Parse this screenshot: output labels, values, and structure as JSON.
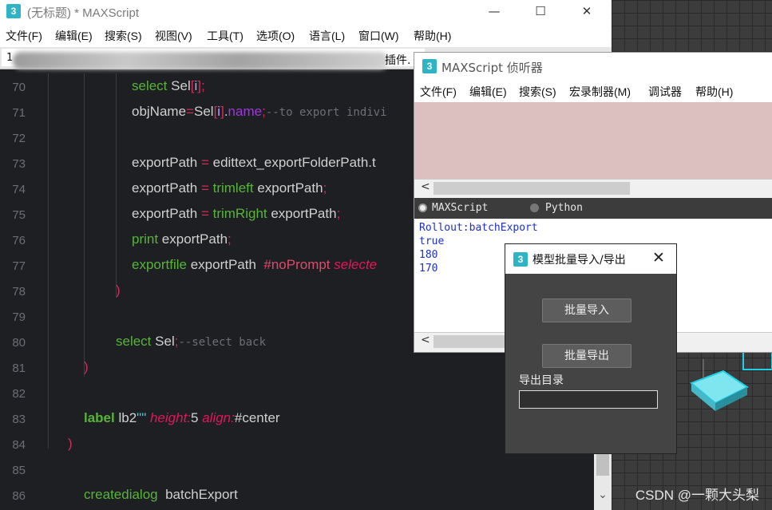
{
  "editor": {
    "title": "(无标题) * MAXScript",
    "logo_char": "3",
    "window_controls": {
      "minimize": "—",
      "maximize": "☐",
      "close": "✕"
    },
    "menu": [
      "文件(F)",
      "编辑(E)",
      "搜索(S)",
      "视图(V)",
      "工具(T)",
      "选项(O)",
      "语言(L)",
      "窗口(W)",
      "帮助(H)"
    ],
    "tab": {
      "index": "1",
      "suffix": "插件."
    },
    "line_numbers": [
      "70",
      "71",
      "72",
      "73",
      "74",
      "75",
      "76",
      "77",
      "78",
      "79",
      "80",
      "81",
      "82",
      "83",
      "84",
      "85",
      "86"
    ]
  },
  "code": {
    "l70": {
      "kw": "select",
      "rest": " Sel",
      "b1": "[",
      "idx": "i",
      "b2": "];"
    },
    "l71": {
      "a": "objName",
      "eq": "=",
      "b": "Sel",
      "b1": "[",
      "idx": "i",
      "b2": "]",
      "dot": ".",
      "prop": "name",
      "semi": ";",
      "cm": "--to export indivi"
    },
    "l73": {
      "a": "exportPath",
      "eq": " = ",
      "b": "edittext_exportFolderPath.t"
    },
    "l74": {
      "a": "exportPath",
      "eq": " = ",
      "fn": "trimleft",
      "b": " exportPath",
      "semi": ";"
    },
    "l75": {
      "a": "exportPath",
      "eq": " = ",
      "fn": "trimRight",
      "b": " exportPath",
      "semi": ";"
    },
    "l76": {
      "fn": "print",
      "b": " exportPath",
      "semi": ";"
    },
    "l77": {
      "fn": "exportfile",
      "b": " exportPath  ",
      "flag": "#noPrompt",
      "it": " selecte"
    },
    "l78": {
      "p": ")"
    },
    "l80": {
      "kw": "select",
      "b": " Sel",
      "semi": ";",
      "cm": "--select back"
    },
    "l81": {
      "p": ")"
    },
    "l83": {
      "kw": "label",
      "b": " lb2",
      "str": "\"\"",
      "it1": " height:",
      "n": "5",
      "it2": " align:",
      "v": "#center"
    },
    "l84": {
      "p": ")"
    },
    "l86": {
      "kw": "createdialog",
      "b": "  batchExport"
    }
  },
  "listener": {
    "title": "MAXScript 侦听器",
    "menu": [
      "文件(F)",
      "编辑(E)",
      "搜索(S)",
      "宏录制器(M)",
      "调试器",
      "帮助(H)"
    ],
    "radio_maxscript": "MAXScript",
    "radio_python": "Python",
    "selected_language": "MAXScript",
    "output": [
      "Rollout:batchExport",
      "true",
      "180",
      "170"
    ],
    "scroll_left": "<"
  },
  "dialog": {
    "title": "模型批量导入/导出",
    "close": "✕",
    "import_button": "批量导入",
    "export_button": "批量导出",
    "dir_label": "导出目录",
    "dir_value": ""
  },
  "watermark": "CSDN @一颗大头梨",
  "scroll_down": "⌄"
}
